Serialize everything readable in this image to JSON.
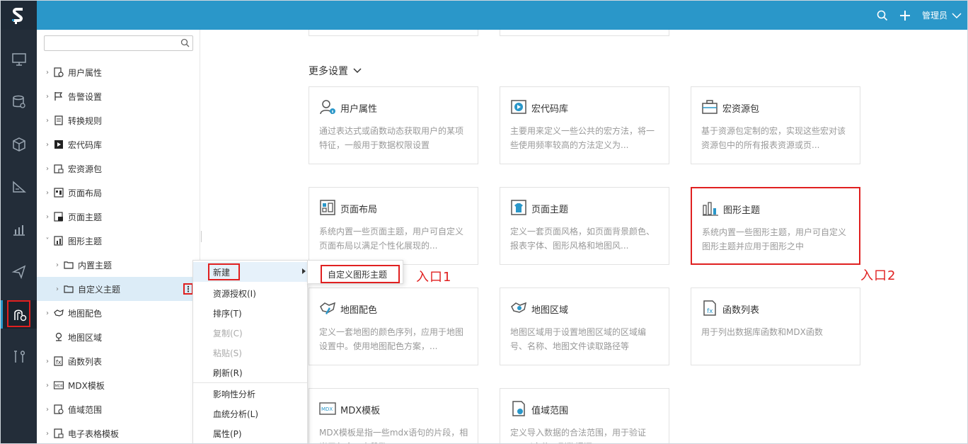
{
  "header": {
    "admin_label": "管理员",
    "brand_color": "#2a97c9",
    "icons": [
      "search-icon",
      "plus-icon",
      "chevron-down-icon"
    ]
  },
  "iconbar": {
    "items": [
      "monitor-icon",
      "database-icon",
      "cube-icon",
      "ruler-icon",
      "chart-icon",
      "send-icon",
      "theme-settings-icon",
      "tools-icon"
    ],
    "active": "theme-settings-icon"
  },
  "tree": {
    "search_placeholder": "",
    "items": [
      {
        "label": "用户属性",
        "expanded": false
      },
      {
        "label": "告警设置",
        "expanded": false
      },
      {
        "label": "转换规则",
        "expanded": false
      },
      {
        "label": "宏代码库",
        "expanded": false
      },
      {
        "label": "宏资源包",
        "expanded": false
      },
      {
        "label": "页面布局",
        "expanded": false
      },
      {
        "label": "页面主题",
        "expanded": false
      },
      {
        "label": "图形主题",
        "expanded": true
      },
      {
        "label": "内置主题",
        "expanded": false
      },
      {
        "label": "自定义主题",
        "expanded": false,
        "selected": true
      },
      {
        "label": "地图配色",
        "expanded": false
      },
      {
        "label": "地图区域",
        "expanded": false
      },
      {
        "label": "函数列表",
        "expanded": false
      },
      {
        "label": "MDX模板",
        "expanded": false
      },
      {
        "label": "值域范围",
        "expanded": false
      },
      {
        "label": "电子表格模板",
        "expanded": false
      }
    ]
  },
  "main": {
    "section_title": "更多设置",
    "cards": [
      {
        "title": "用户属性",
        "desc": "通过表达式或函数动态获取用户的某项特征，一般用于数据权限设置"
      },
      {
        "title": "宏代码库",
        "desc": "主要用来定义一些公共的宏方法，将一些使用频率较高的方法定义为..."
      },
      {
        "title": "宏资源包",
        "desc": "基于资源包定制的宏，实现这些宏对该资源包中的所有报表资源或页..."
      },
      {
        "title": "页面布局",
        "desc": "系统内置一些页面主题，用户可自定义页面布局以满足个性化展现的..."
      },
      {
        "title": "页面主题",
        "desc": "定义一套页面风格，如页面背景颜色、报表字体、图形风格和地图风..."
      },
      {
        "title": "图形主题",
        "desc": "系统内置一些图形主题，用户可自定义图形主题并应用于图形之中"
      },
      {
        "title": "地图配色",
        "desc": "定义一套地图的颜色序列，应用于地图设置中。使用地图配色方案，..."
      },
      {
        "title": "地图区域",
        "desc": "地图区域用于设置地图区域的区域编号、名称、地图文件读取路径等"
      },
      {
        "title": "函数列表",
        "desc": "用于列出数据库函数和MDX函数"
      },
      {
        "title": "MDX模板",
        "desc": "MDX模板是指一些mdx语句的片段，相当于包含一大段数"
      },
      {
        "title": "值域范围",
        "desc": "定义导入数据的合法范围，用于验证Excel文件，到数据源..."
      }
    ]
  },
  "context_menu": {
    "items": [
      "新建",
      "资源授权(I)",
      "排序(T)",
      "复制(C)",
      "粘贴(S)",
      "刷新(R)",
      "影响性分析",
      "血统分析(L)",
      "属性(P)"
    ],
    "disabled": [
      "复制(C)",
      "粘贴(S)"
    ],
    "submenu": [
      "自定义图形主题"
    ]
  },
  "annotations": {
    "entry1": "入口1",
    "entry2": "入口2"
  },
  "colors": {
    "highlight": "#e02020",
    "sidebar_dark": "#232d39",
    "selected_row": "#dcecf7"
  }
}
